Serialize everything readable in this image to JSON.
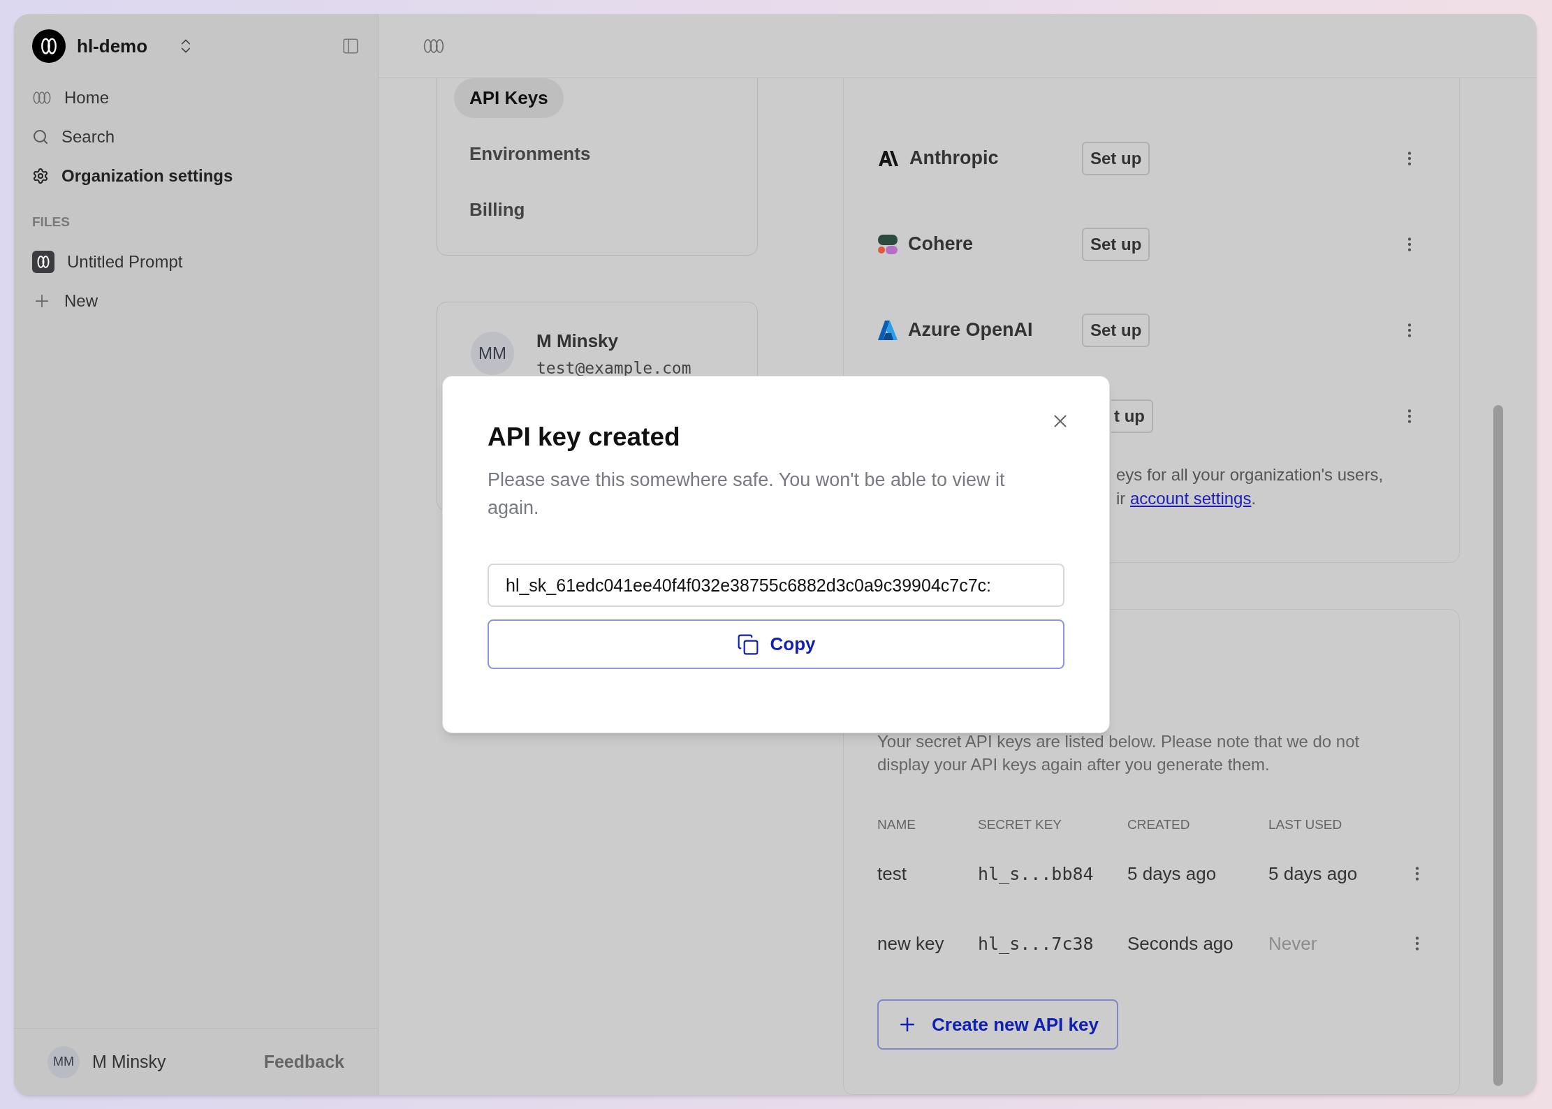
{
  "workspace": {
    "name": "hl-demo"
  },
  "sidebar": {
    "nav": [
      {
        "label": "Home",
        "kind": "home",
        "selected": false
      },
      {
        "label": "Search",
        "kind": "search",
        "selected": false
      },
      {
        "label": "Organization settings",
        "kind": "settings",
        "selected": true
      }
    ],
    "files_heading": "FILES",
    "files": [
      {
        "label": "Untitled Prompt",
        "kind": "file"
      },
      {
        "label": "New",
        "kind": "action"
      }
    ],
    "user": {
      "initials": "MM",
      "name": "M Minsky"
    },
    "feedback": "Feedback"
  },
  "settings_nav": [
    {
      "label": "API Keys",
      "selected": true
    },
    {
      "label": "Environments",
      "selected": false
    },
    {
      "label": "Billing",
      "selected": false
    }
  ],
  "profile": {
    "initials": "MM",
    "name": "M Minsky",
    "email": "test@example.com"
  },
  "providers": [
    {
      "kind": "anthropic",
      "name": "Anthropic",
      "button": "Set up"
    },
    {
      "kind": "cohere",
      "name": "Cohere",
      "button": "Set up"
    },
    {
      "kind": "azure",
      "name": "Azure OpenAI",
      "button": "Set up"
    },
    {
      "kind": "covered",
      "button": "t up"
    }
  ],
  "providers_note": {
    "line_1": "eys for all your organization's users,",
    "line_2": "ir ",
    "link": "account settings",
    "end": "."
  },
  "api_keys": {
    "description": "Your secret API keys are listed below. Please note that we do not display your API keys again after you generate them.",
    "columns": [
      "NAME",
      "SECRET KEY",
      "CREATED",
      "LAST USED"
    ],
    "rows": [
      {
        "name": "test",
        "secret": "hl_s...bb84",
        "created": "5 days ago",
        "last_used": "5 days ago",
        "never_used": false
      },
      {
        "name": "new key",
        "secret": "hl_s...7c38",
        "created": "Seconds ago",
        "last_used": "Never",
        "never_used": true
      }
    ],
    "create_button": "Create new API key"
  },
  "modal": {
    "title": "API key created",
    "message": "Please save this somewhere safe. You won't be able to view it again.",
    "key_value": "hl_sk_61edc041ee40f4f032e38755c6882d3c0a9c39904c7c7c:",
    "copy_button": "Copy"
  }
}
